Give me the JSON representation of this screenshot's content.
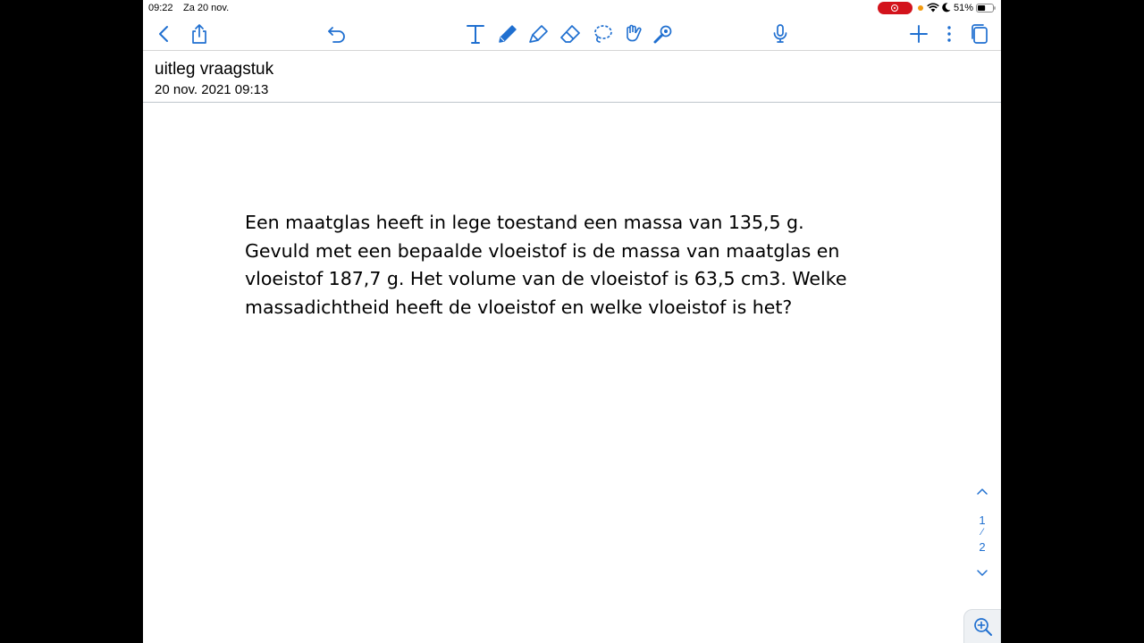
{
  "status_bar": {
    "time": "09:22",
    "date": "Za 20 nov.",
    "battery_percent": "51%",
    "battery_level": 0.51,
    "recording_color": "#d3131c"
  },
  "toolbar": {
    "accent_color": "#1f6fd0",
    "icons": [
      "back-chevron-icon",
      "share-icon",
      "undo-icon",
      "text-tool-icon",
      "pen-tool-icon",
      "highlighter-icon",
      "eraser-icon",
      "lasso-icon",
      "shapes-icon",
      "laser-pointer-icon",
      "microphone-icon",
      "add-icon",
      "more-icon",
      "pages-icon"
    ]
  },
  "document": {
    "title": "uitleg vraagstuk",
    "date": "20 nov. 2021 09:13"
  },
  "question": {
    "lines": [
      "Een maatglas heeft in lege toestand een massa van 135,5 g.",
      "Gevuld met een bepaalde vloeistof is de massa van maatglas en",
      "vloeistof 187,7 g. Het volume van de vloeistof is 63,5 cm3. Welke",
      "massadichtheid heeft de vloeistof en welke vloeistof is het?"
    ]
  },
  "page_nav": {
    "current": "1",
    "separator": "⁄",
    "total": "2"
  }
}
